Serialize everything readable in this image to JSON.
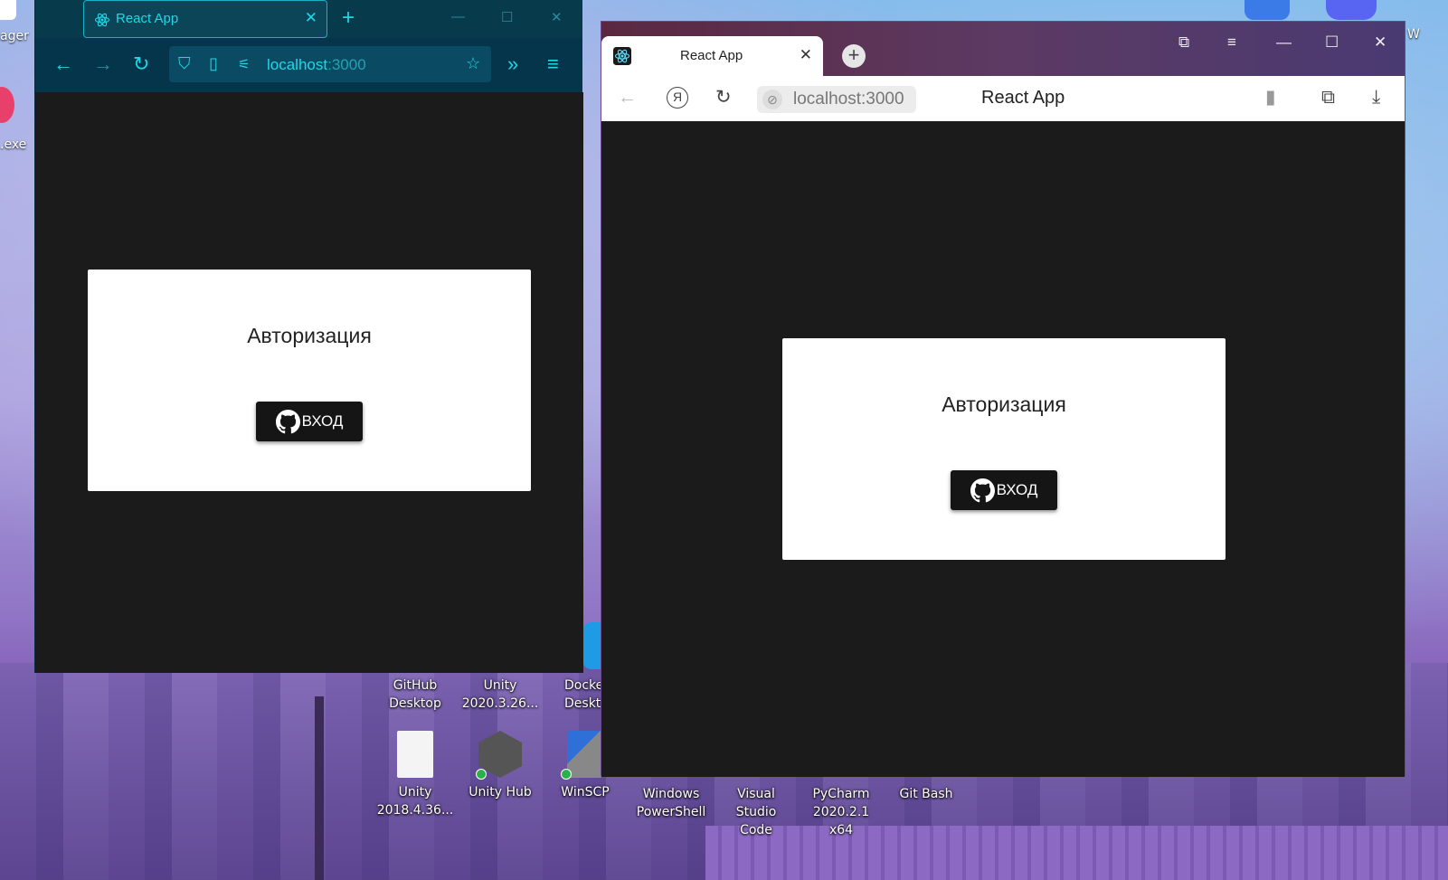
{
  "desktop": {
    "icons": [
      {
        "label": "GitHub\nDesktop",
        "id": "github-desktop"
      },
      {
        "label": "Unity\n2020.3.26...",
        "id": "unity-2020"
      },
      {
        "label": "Docke\nDeskto",
        "id": "docker-desktop"
      },
      {
        "label": "Unity\n2018.4.36...",
        "id": "unity-2018"
      },
      {
        "label": "Unity Hub",
        "id": "unity-hub"
      },
      {
        "label": "WinSCP",
        "id": "winscp"
      },
      {
        "label": "Windows\nPowerShell",
        "id": "powershell"
      },
      {
        "label": "Visual Studio\nCode",
        "id": "vscode"
      },
      {
        "label": "PyCharm\n2020.2.1 x64",
        "id": "pycharm"
      },
      {
        "label": "Git Bash",
        "id": "git-bash"
      }
    ],
    "partial_left_labels": [
      "ager",
      ".exe"
    ]
  },
  "firefox": {
    "tab_title": "React App",
    "url_host": "localhost",
    "url_port": ":3000",
    "accent": "#22d6e6"
  },
  "yandex": {
    "tab_title": "React App",
    "url": "localhost:3000",
    "page_title": "React App"
  },
  "app": {
    "heading": "Авторизация",
    "login_label": "ВХОД",
    "background": "#1b1b1b"
  }
}
